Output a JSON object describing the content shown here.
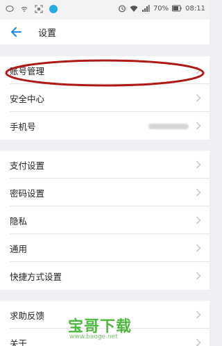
{
  "status_bar": {
    "battery": "70%",
    "time": "08:11"
  },
  "header": {
    "title": "设置"
  },
  "section1": [
    {
      "label": "账号管理"
    },
    {
      "label": "安全中心"
    },
    {
      "label": "手机号"
    }
  ],
  "section2": [
    {
      "label": "支付设置"
    },
    {
      "label": "密码设置"
    },
    {
      "label": "隐私"
    },
    {
      "label": "通用"
    },
    {
      "label": "快捷方式设置"
    }
  ],
  "section3": [
    {
      "label": "求助反馈"
    },
    {
      "label": "关于"
    }
  ],
  "watermark": {
    "brand": "宝哥下载",
    "url": "www.baoge.net"
  },
  "colors": {
    "accent": "#1e88e5",
    "highlight": "#b01818",
    "watermark": "#4cb83d"
  }
}
